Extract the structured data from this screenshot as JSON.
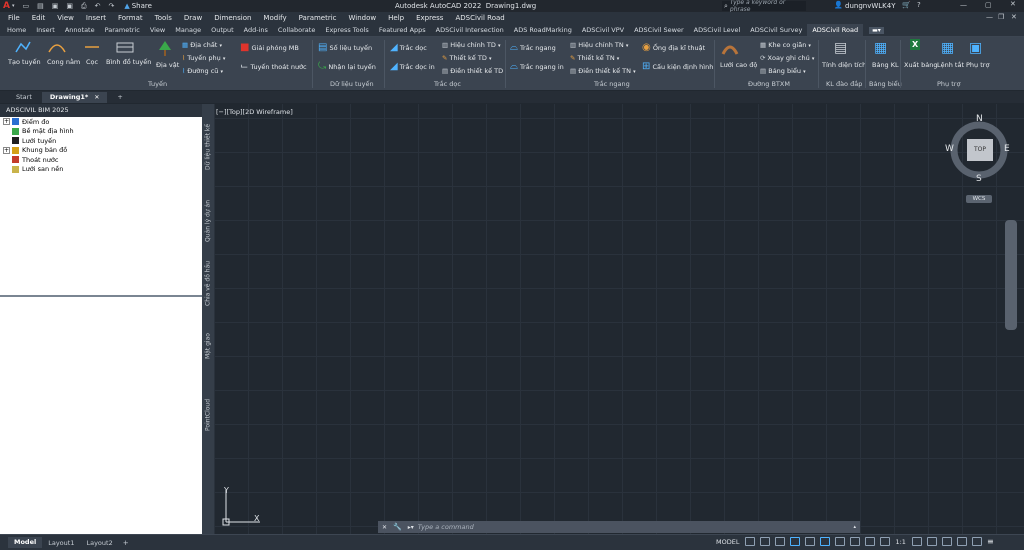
{
  "titlebar": {
    "share_label": "Share",
    "app_title": "Autodesk AutoCAD 2022",
    "file_name": "Drawing1.dwg",
    "search_placeholder": "Type a keyword or phrase",
    "user_name": "dungnvWLK4Y"
  },
  "menubar": {
    "items": [
      "File",
      "Edit",
      "View",
      "Insert",
      "Format",
      "Tools",
      "Draw",
      "Dimension",
      "Modify",
      "Parametric",
      "Window",
      "Help",
      "Express",
      "ADSCivil Road"
    ]
  },
  "ribbon_tabs": {
    "items": [
      "Home",
      "Insert",
      "Annotate",
      "Parametric",
      "View",
      "Manage",
      "Output",
      "Add-ins",
      "Collaborate",
      "Express Tools",
      "Featured Apps",
      "ADSCivil Intersection",
      "ADS RoadMarking",
      "ADSCivil VPV",
      "ADSCivil Sewer",
      "ADSCivil Level",
      "ADSCivil Survey",
      "ADSCivil Road"
    ],
    "active": "ADSCivil Road"
  },
  "ribbon": {
    "tuyen": {
      "tao_tuyen": "Tạo tuyến",
      "cong_nam": "Cong nằm",
      "coc": "Cọc",
      "binh_do_tuyen": "Bình đồ tuyến",
      "dia_vat": "Địa vật",
      "dia_chat": "Địa chất",
      "tuyen_phu": "Tuyến phụ",
      "duong_cu": "Đường cũ",
      "giai_phong_mb": "Giải phóng MB",
      "tuyen_thoat_nuoc": "Tuyến thoát nước",
      "label": "Tuyến"
    },
    "du_lieu_tuyen": {
      "so_lieu_tuyen": "Số liệu tuyến",
      "nhan_lai_tuyen": "Nhận lại tuyến",
      "label": "Dữ liệu tuyến"
    },
    "trac_doc": {
      "trac_doc": "Trắc dọc",
      "trac_doc_in": "Trắc dọc in",
      "hieu_chinh_td": "Hiệu chỉnh TD",
      "thiet_ke_td": "Thiết kế TD",
      "dien_thiet_ke_td": "Điền thiết kế TD",
      "label": "Trắc dọc"
    },
    "trac_ngang": {
      "trac_ngang": "Trắc ngang",
      "trac_ngang_in": "Trắc ngang in",
      "hieu_chinh_tn": "Hiệu chỉnh TN",
      "thiet_ke_tn": "Thiết kế TN",
      "dien_thiet_ke_tn": "Điền thiết kế TN",
      "ong_dia_ki_thuat": "Ống địa kĩ thuật",
      "cau_kien_dinh_hinh": "Cấu kiện định hình",
      "label": "Trắc ngang"
    },
    "duong_btxm": {
      "luoi_cao_do": "Lưới cao độ",
      "khe_co_gian": "Khe co giãn",
      "xoay_ghi_chu": "Xoay ghi chú",
      "bang_bieu": "Bảng biểu",
      "label": "Đường BTXM"
    },
    "kl_dao_dap": {
      "tinh_dien_tich": "Tính diện tích",
      "label": "KL đào đắp"
    },
    "bang_bieu": {
      "bang_kl": "Bảng KL",
      "label": "Bảng biểu"
    },
    "phu_tro": {
      "xuat_bang": "Xuất bảng",
      "lenh_tat": "Lệnh tắt",
      "phu_tro": "Phụ trợ",
      "label": "Phụ trợ"
    }
  },
  "doc_tabs": {
    "start": "Start",
    "drawing": "Drawing1*",
    "add": "+"
  },
  "palette": {
    "title": "ADSCIVIL BIM 2025",
    "tree": [
      {
        "label": "Điểm đo",
        "expand": "+",
        "color": "#2a6fd1"
      },
      {
        "label": "Bề mặt địa hình",
        "expand": "",
        "color": "#3aa84a"
      },
      {
        "label": "Lưới tuyến",
        "expand": "",
        "color": "#202020"
      },
      {
        "label": "Khung bản đồ",
        "expand": "+",
        "color": "#d4a017"
      },
      {
        "label": "Thoát nước",
        "expand": "",
        "color": "#c43b2a"
      },
      {
        "label": "Lưới san nền",
        "expand": "",
        "color": "#c9b34a"
      }
    ]
  },
  "vertical_tabs": [
    "Dữ liệu thiết kế",
    "Quản lý dự án",
    "Chia vẽ đồ hầu",
    "Mặt giao",
    "PointCloud"
  ],
  "viewport": {
    "label": "[−][Top][2D Wireframe]",
    "compass": {
      "n": "N",
      "s": "S",
      "e": "E",
      "w": "W",
      "center": "TOP"
    },
    "ucs_label": "WCS",
    "axis_x": "X",
    "axis_y": "Y"
  },
  "command": {
    "placeholder": "Type a command"
  },
  "layout_tabs": {
    "model": "Model",
    "layout1": "Layout1",
    "layout2": "Layout2",
    "add": "+"
  },
  "statusbar": {
    "model": "MODEL",
    "scale": "1:1"
  }
}
